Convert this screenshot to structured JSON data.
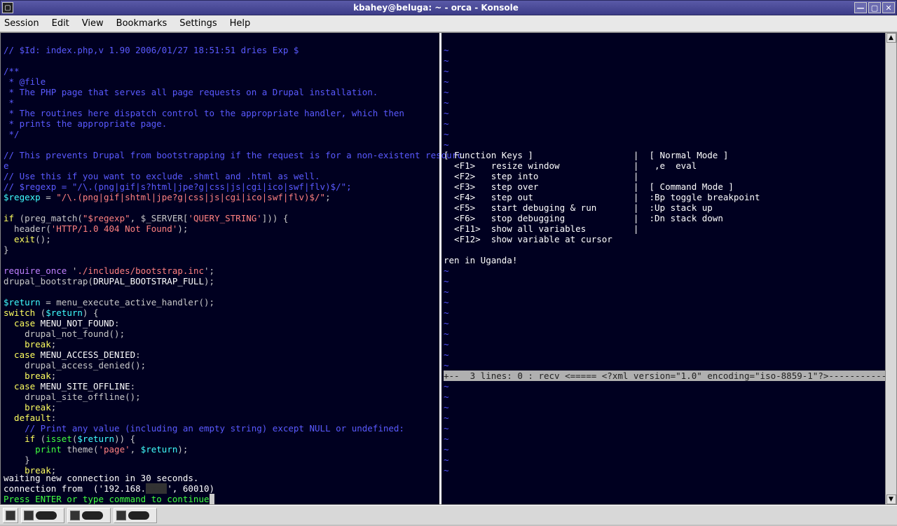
{
  "window": {
    "title": "kbahey@beluga: ~ - orca - Konsole"
  },
  "menu": {
    "session": "Session",
    "edit": "Edit",
    "view": "View",
    "bookmarks": "Bookmarks",
    "settings": "Settings",
    "help": "Help"
  },
  "code": {
    "l01": "// $Id: index.php,v 1.90 2006/01/27 18:51:51 dries Exp $",
    "l02": "",
    "l03": "/**",
    "l04": " * @file",
    "l05": " * The PHP page that serves all page requests on a Drupal installation.",
    "l06": " *",
    "l07": " * The routines here dispatch control to the appropriate handler, which then",
    "l08": " * prints the appropriate page.",
    "l09": " */",
    "l10": "",
    "l11a": "// This prevents Drupal from bootstrapping if the request is for a non-existent resourc",
    "l11b": "e",
    "l12": "// Use this if you want to exclude .shmtl and .html as well.",
    "l13": "// $regexp = \"/\\.(png|gif|s?html|jpe?g|css|js|cgi|ico|swf|flv)$/\";",
    "l14a": "$regexp",
    "l14b": " = ",
    "l14c": "\"/\\.(png|gif|shtml|jpe?g|css|js|cgi|ico|swf|flv)$/\"",
    "l14d": ";",
    "l15": "",
    "l16a": "if",
    "l16b": " (preg_match(",
    "l16c": "\"$regexp\"",
    "l16d": ", $_SERVER[",
    "l16e": "'QUERY_STRING'",
    "l16f": "])) {",
    "l17a": "  header(",
    "l17b": "'HTTP/1.0 404 Not Found'",
    "l17c": ");",
    "l18a": "  exit",
    "l18b": "();",
    "l19": "}",
    "l20": "",
    "l21a": "require_once",
    "l21b": " '",
    "l21c": "./includes/bootstrap.inc",
    "l21d": "';",
    "l22a": "drupal_bootstrap(",
    "l22b": "DRUPAL_BOOTSTRAP_FULL",
    "l22c": ");",
    "l23": "",
    "l24a": "$return",
    "l24b": " = menu_execute_active_handler();",
    "l25a": "switch",
    "l25b": " (",
    "l25c": "$return",
    "l25d": ") {",
    "l26a": "  case",
    "l26b": " MENU_NOT_FOUND",
    "l26c": ":",
    "l27": "    drupal_not_found();",
    "l28a": "    break",
    "l28b": ";",
    "l29a": "  case",
    "l29b": " MENU_ACCESS_DENIED",
    "l29c": ":",
    "l30": "    drupal_access_denied();",
    "l31a": "    break",
    "l31b": ";",
    "l32a": "  case",
    "l32b": " MENU_SITE_OFFLINE",
    "l32c": ":",
    "l33": "    drupal_site_offline();",
    "l34a": "    break",
    "l34b": ";",
    "l35a": "  default",
    "l35b": ":",
    "l36": "    // Print any value (including an empty string) except NULL or undefined:",
    "l37a": "    if",
    "l37b": " (",
    "l37c": "isset",
    "l37d": "(",
    "l37e": "$return",
    "l37f": ")) {",
    "l38a": "      print",
    "l38b": " theme(",
    "l38c": "'page'",
    "l38d": ", ",
    "l38e": "$return",
    "l38f": ");",
    "l39": "    }",
    "l40a": "    break",
    "l40b": ";"
  },
  "right": {
    "head": "[ Function Keys ]                   |  [ Normal Mode ]",
    "f1": "  <F1>   resize window              |   ,e  eval",
    "f2": "  <F2>   step into                  |",
    "f3": "  <F3>   step over                  |  [ Command Mode ]",
    "f4": "  <F4>   step out                   |  :Bp toggle breakpoint",
    "f5": "  <F5>   start debuging & run       |  :Up stack up",
    "f6": "  <F6>   stop debugging             |  :Dn stack down",
    "f11": "  <F11>  show all variables         |",
    "f12": "  <F12>  show variable at cursor",
    "rem": "ren in Uganda!",
    "fold": "+--  3 lines: 0 : recv <===== <?xml version=\"1.0\" encoding=\"iso-8859-1\"?>-------------------"
  },
  "status": {
    "l1": "waiting new connection in 30 seconds.",
    "l2a": "connection from  ('192.168.",
    "l2b": "', 60010)",
    "prompt": "Press ENTER or type command to continue"
  }
}
